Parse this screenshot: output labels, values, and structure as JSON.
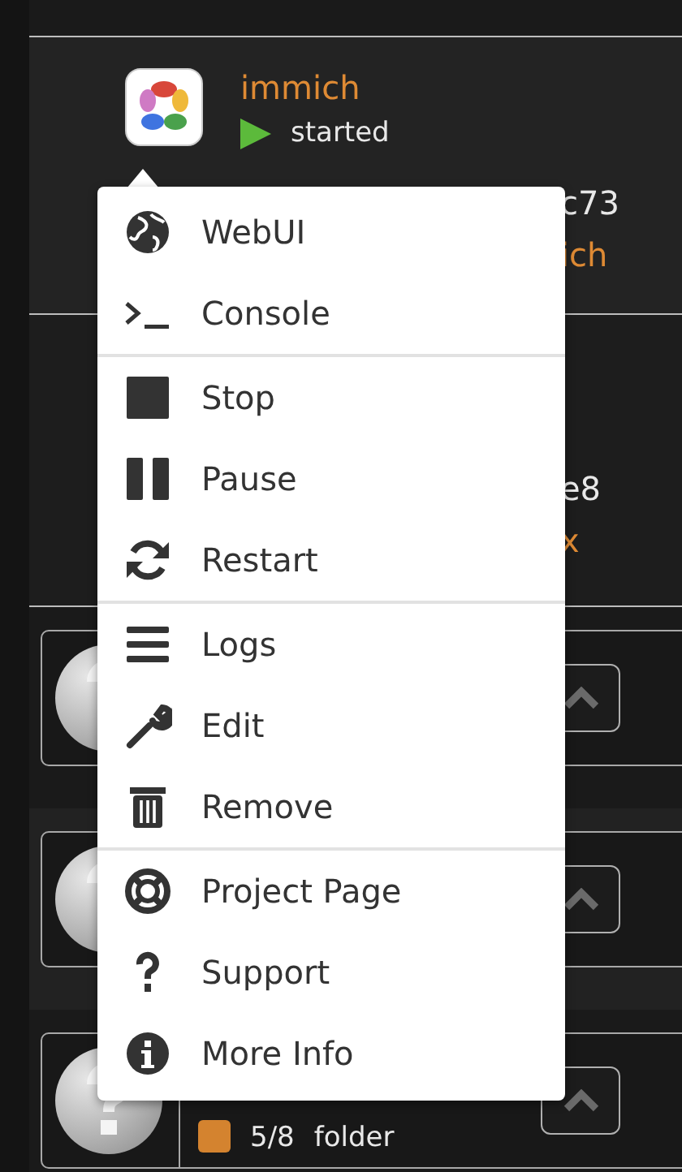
{
  "container": {
    "name": "immich",
    "status": "started",
    "running": true,
    "fragments": [
      {
        "text": "c73",
        "kind": "plain"
      },
      {
        "text": "ich",
        "kind": "accent"
      }
    ]
  },
  "second_row": {
    "fragments": [
      {
        "text": "e8",
        "kind": "plain"
      },
      {
        "text": "x",
        "kind": "accent"
      }
    ]
  },
  "menu": {
    "sections": [
      [
        {
          "kind": "globe",
          "label": "WebUI"
        },
        {
          "kind": "terminal",
          "label": "Console"
        }
      ],
      [
        {
          "kind": "stop",
          "label": "Stop"
        },
        {
          "kind": "pause",
          "label": "Pause"
        },
        {
          "kind": "restart",
          "label": "Restart"
        }
      ],
      [
        {
          "kind": "list",
          "label": "Logs"
        },
        {
          "kind": "wrench",
          "label": "Edit"
        },
        {
          "kind": "trash",
          "label": "Remove"
        }
      ],
      [
        {
          "kind": "lifebuoy",
          "label": "Project Page"
        },
        {
          "kind": "question",
          "label": "Support"
        },
        {
          "kind": "info",
          "label": "More Info"
        }
      ]
    ]
  },
  "cards": [
    {
      "kind": "plain"
    },
    {
      "kind": "plain"
    },
    {
      "kind": "folder",
      "count": "5/8",
      "label": "folder",
      "color": "#d4832f"
    }
  ]
}
